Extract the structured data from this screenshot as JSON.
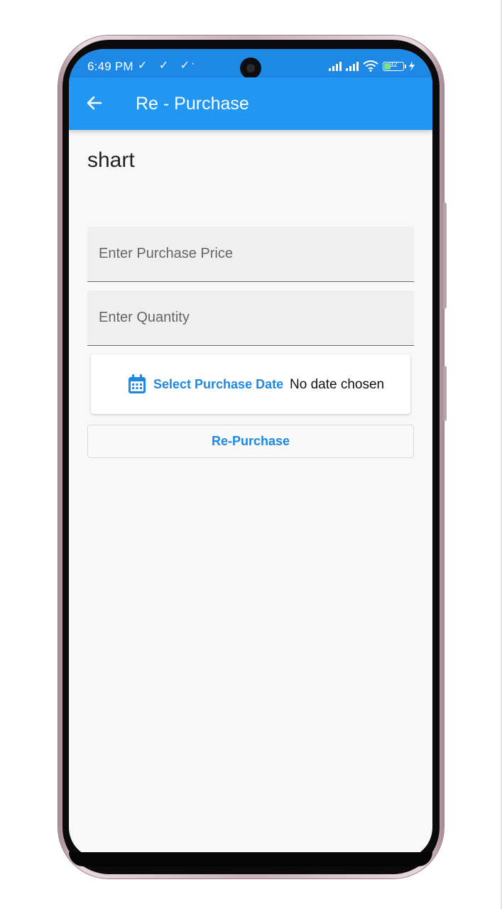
{
  "status_bar": {
    "time": "6:49 PM",
    "notification_checks": "✓ ✓ ✓",
    "dot": "·",
    "battery_level": "32"
  },
  "app_bar": {
    "back_icon": "arrow-left-icon",
    "title": "Re - Purchase"
  },
  "product": {
    "name": "shart"
  },
  "form": {
    "price_placeholder": "Enter Purchase Price",
    "price_value": "",
    "quantity_placeholder": "Enter Quantity",
    "quantity_value": "",
    "date_button_icon": "calendar-icon",
    "date_button_label": "Select Purchase Date",
    "date_value": "No date chosen",
    "submit_label": "Re-Purchase"
  },
  "colors": {
    "app_bar": "#2196f3",
    "status_bar": "#1e88e5",
    "accent": "#1e88e5",
    "background": "#f8f8f8"
  }
}
